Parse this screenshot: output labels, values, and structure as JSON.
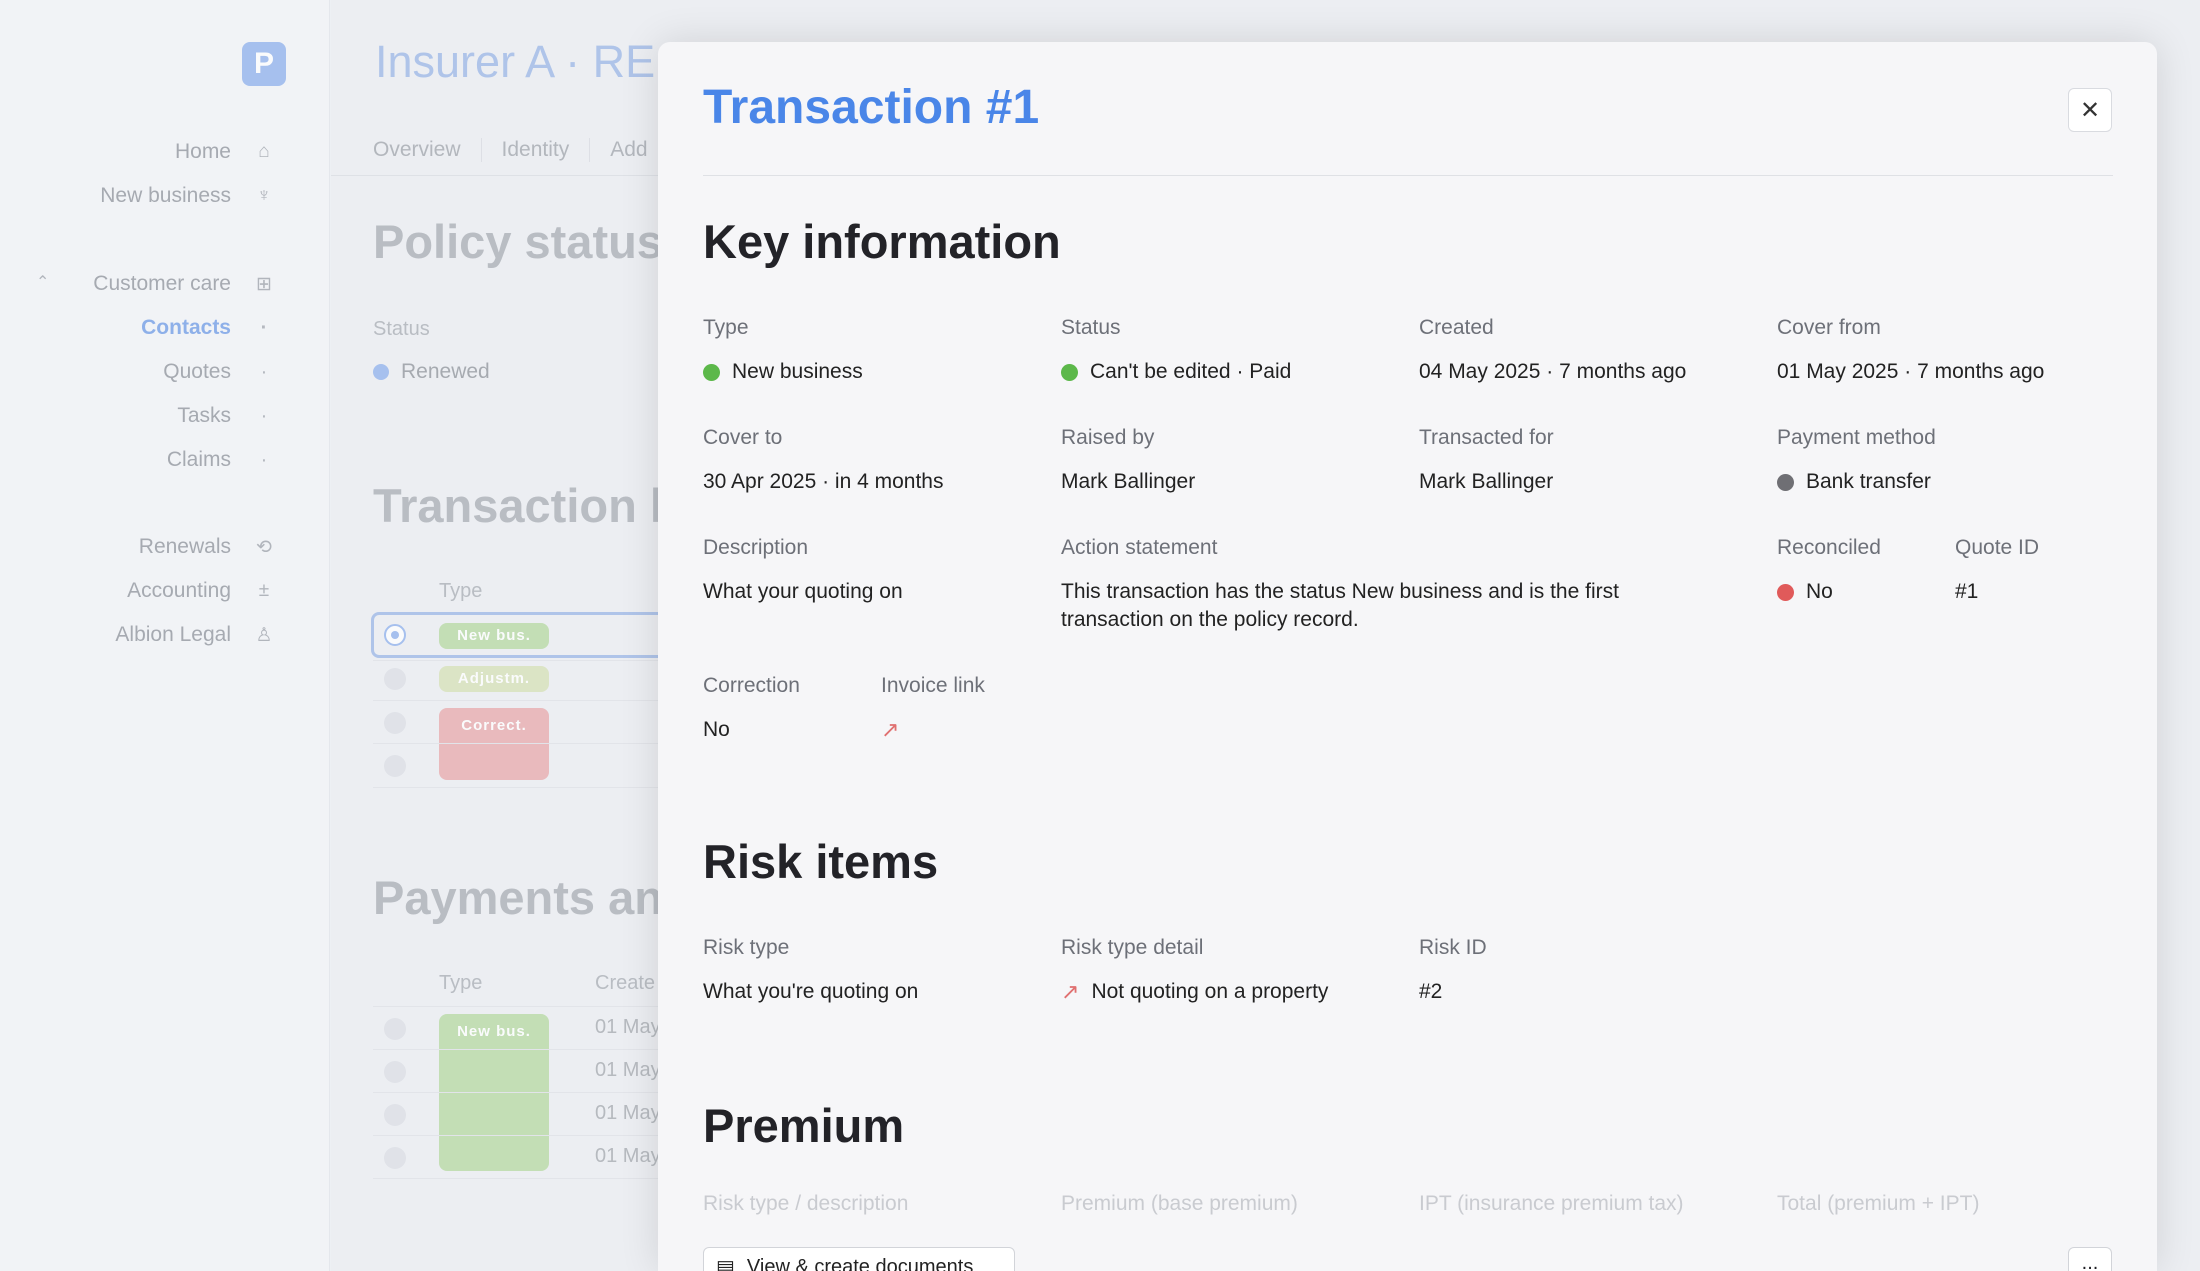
{
  "sidebar": {
    "logo": "P",
    "items": [
      {
        "label": "Home",
        "icon": "home-icon"
      },
      {
        "label": "New business",
        "icon": "new-business-icon"
      },
      {
        "label": "Customer care",
        "icon": "grid-icon"
      },
      {
        "label": "Contacts",
        "icon": "dot"
      },
      {
        "label": "Quotes",
        "icon": "dot"
      },
      {
        "label": "Tasks",
        "icon": "dot"
      },
      {
        "label": "Claims",
        "icon": "dot"
      },
      {
        "label": "Renewals",
        "icon": "renew-icon"
      },
      {
        "label": "Accounting",
        "icon": "calculator-icon"
      },
      {
        "label": "Albion Legal",
        "icon": "user-icon"
      }
    ]
  },
  "background": {
    "title": "Insurer A · RE",
    "tabs": [
      "Overview",
      "Identity",
      "Add"
    ],
    "policy_status_heading": "Policy status",
    "status_label": "Status",
    "status_value": "Renewed",
    "transaction_heading": "Transaction h",
    "type_col": "Type",
    "tx_pills": [
      "New bus.",
      "Adjustm.",
      "Correct."
    ],
    "payments_heading": "Payments anc",
    "payments_type_col": "Type",
    "payments_created_col": "Create",
    "pay_pill": "New bus.",
    "pay_dates": [
      "01 May",
      "01 May",
      "01 May",
      "01 May"
    ],
    "colors": {
      "blue": "#8fb0ec",
      "green": "#b6d9a0",
      "olive": "#d6e0b6",
      "red": "#e8a9ab"
    }
  },
  "drawer": {
    "title": "Transaction #1",
    "key_heading": "Key information",
    "fields": {
      "type": {
        "label": "Type",
        "value": "New business",
        "color": "#5cb84a"
      },
      "status": {
        "label": "Status",
        "value": "Can't be edited · Paid",
        "color": "#5cb84a"
      },
      "created": {
        "label": "Created",
        "value": "04 May 2025 · 7 months ago"
      },
      "cover_from": {
        "label": "Cover from",
        "value": "01 May 2025 · 7 months ago"
      },
      "cover_to": {
        "label": "Cover to",
        "value": "30 Apr 2025 · in 4 months"
      },
      "raised_by": {
        "label": "Raised by",
        "value": "Mark Ballinger"
      },
      "transacted_for": {
        "label": "Transacted for",
        "value": "Mark Ballinger"
      },
      "payment_method": {
        "label": "Payment method",
        "value": "Bank transfer",
        "color": "#6f6f74"
      },
      "description": {
        "label": "Description",
        "value": "What your quoting on"
      },
      "action_statement": {
        "label": "Action statement",
        "value": "This transaction has the status New business and is the first transaction on the policy record."
      },
      "reconciled": {
        "label": "Reconciled",
        "value": "No",
        "color": "#e05a5a"
      },
      "quote_id": {
        "label": "Quote ID",
        "value": "#1"
      },
      "correction": {
        "label": "Correction",
        "value": "No"
      },
      "invoice_link": {
        "label": "Invoice link"
      }
    },
    "risk_heading": "Risk items",
    "risk": {
      "type_label": "Risk type",
      "type_value": "What you're quoting on",
      "detail_label": "Risk type detail",
      "detail_value": "Not quoting on a property",
      "id_label": "Risk ID",
      "id_value": "#2"
    },
    "premium_heading": "Premium",
    "premium_cols": [
      "Risk type / description",
      "Premium (base premium)",
      "IPT (insurance premium tax)",
      "Total (premium + IPT)"
    ],
    "doc_button": "View & create documents",
    "more_button": "..."
  }
}
